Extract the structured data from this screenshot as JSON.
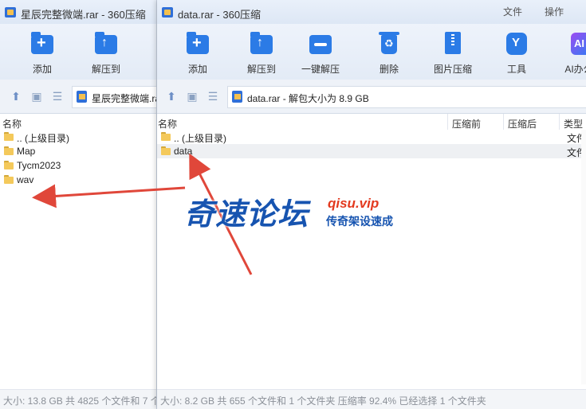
{
  "left_window": {
    "title": "星辰完整微端.rar - 360压缩",
    "toolbar": [
      {
        "label": "添加",
        "icon": "add-icon"
      },
      {
        "label": "解压到",
        "icon": "extract-icon"
      }
    ],
    "address": "星辰完整微端.rar",
    "column_name": "名称",
    "files": [
      {
        "name": ".. (上级目录)"
      },
      {
        "name": "Map"
      },
      {
        "name": "Tycm2023"
      },
      {
        "name": "wav"
      }
    ],
    "status": "大小: 13.8 GB 共 4825 个文件和 7 个"
  },
  "right_window": {
    "title": "data.rar - 360压缩",
    "menu": [
      "文件",
      "操作"
    ],
    "toolbar": [
      {
        "label": "添加",
        "icon": "add-icon"
      },
      {
        "label": "解压到",
        "icon": "extract-icon"
      },
      {
        "label": "一键解压",
        "icon": "one-click-extract-icon"
      },
      {
        "label": "删除",
        "icon": "delete-icon"
      },
      {
        "label": "图片压缩",
        "icon": "image-compress-icon"
      },
      {
        "label": "工具",
        "icon": "tools-icon"
      },
      {
        "label": "AI办公",
        "icon": "ai-office-icon"
      }
    ],
    "address": "data.rar - 解包大小为 8.9 GB",
    "columns": [
      "名称",
      "压缩前",
      "压缩后",
      "类型"
    ],
    "files": [
      {
        "name": ".. (上级目录)",
        "type": "文件"
      },
      {
        "name": "data",
        "type": "文件",
        "selected": true
      }
    ],
    "status": "大小: 8.2 GB 共 655 个文件和 1 个文件夹 压缩率 92.4% 已经选择 1 个文件夹"
  },
  "watermark": {
    "main": "奇速论坛",
    "url": "qisu.vip",
    "sub": "传奇架设速成"
  },
  "colors": {
    "accent": "#2b7be6",
    "arrow": "#e0473a",
    "watermark_blue": "#1754b0",
    "watermark_red": "#e33a1f"
  }
}
